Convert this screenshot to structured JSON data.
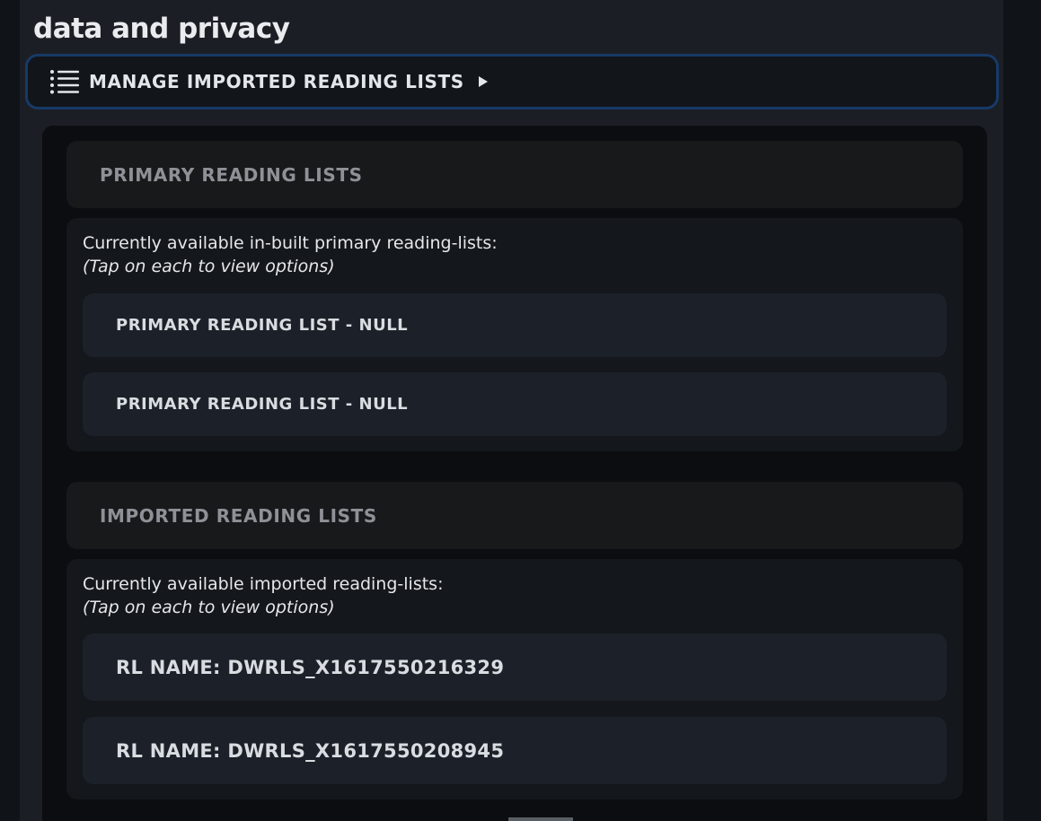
{
  "page": {
    "title": "data and privacy"
  },
  "manage_button": {
    "label": "MANAGE IMPORTED READING LISTS",
    "icon": "list-icon",
    "arrow_icon": "play-arrow-icon"
  },
  "primary_section": {
    "header": "PRIMARY READING LISTS",
    "description": "Currently available in-built primary reading-lists:",
    "hint": "(Tap on each to view options)",
    "items": [
      {
        "label": "PRIMARY READING LIST - NULL"
      },
      {
        "label": "PRIMARY READING LIST - NULL"
      }
    ]
  },
  "imported_section": {
    "header": "IMPORTED READING LISTS",
    "description": "Currently available imported reading-lists:",
    "hint": "(Tap on each to view options)",
    "items": [
      {
        "label": "RL NAME: DWRLS_X1617550216329"
      },
      {
        "label": "RL NAME: DWRLS_X1617550208945"
      }
    ]
  },
  "colors": {
    "accent_border": "#173a67",
    "background": "#0b0d10",
    "item_background": "#1c2129"
  }
}
